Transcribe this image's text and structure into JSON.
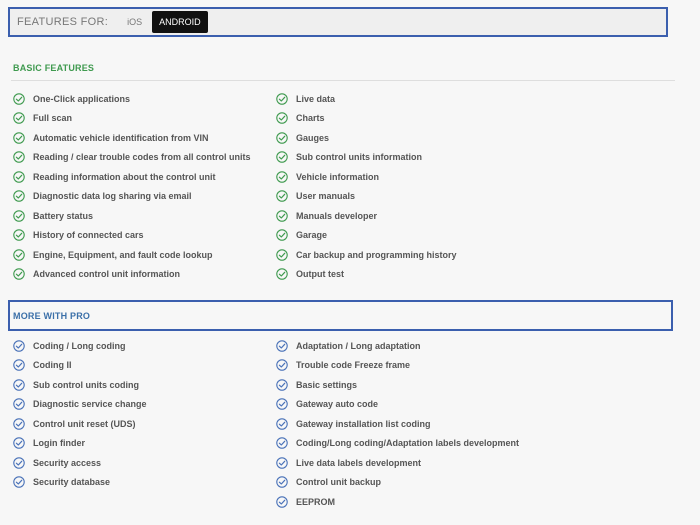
{
  "header": {
    "label": "FEATURES FOR:",
    "tabs": [
      {
        "label": "iOS",
        "active": false
      },
      {
        "label": "ANDROID",
        "active": true
      }
    ]
  },
  "basic": {
    "title": "BASIC FEATURES",
    "check_color": "#3f9a4f",
    "left": [
      "One-Click applications",
      "Full scan",
      "Automatic vehicle identification from VIN",
      "Reading / clear trouble codes from all control units",
      "Reading information about the control unit",
      "Diagnostic data log sharing via email",
      "Battery status",
      "History of connected cars",
      "Engine, Equipment, and fault code lookup",
      "Advanced control unit information"
    ],
    "right": [
      "Live data",
      "Charts",
      "Gauges",
      "Sub control units information",
      "Vehicle information",
      "User manuals",
      "Manuals developer",
      "Garage",
      "Car backup and programming history",
      "Output test"
    ]
  },
  "pro": {
    "title": "MORE WITH PRO",
    "check_color": "#4a72b8",
    "left": [
      "Coding / Long coding",
      "Coding II",
      "Sub control units coding",
      "Diagnostic service change",
      "Control unit reset (UDS)",
      "Login finder",
      "Security access",
      "Security database"
    ],
    "right": [
      "Adaptation / Long adaptation",
      "Trouble code Freeze frame",
      "Basic settings",
      "Gateway auto code",
      "Gateway installation list coding",
      "Coding/Long coding/Adaptation labels development",
      "Live data labels development",
      "Control unit backup",
      "EEPROM"
    ]
  }
}
